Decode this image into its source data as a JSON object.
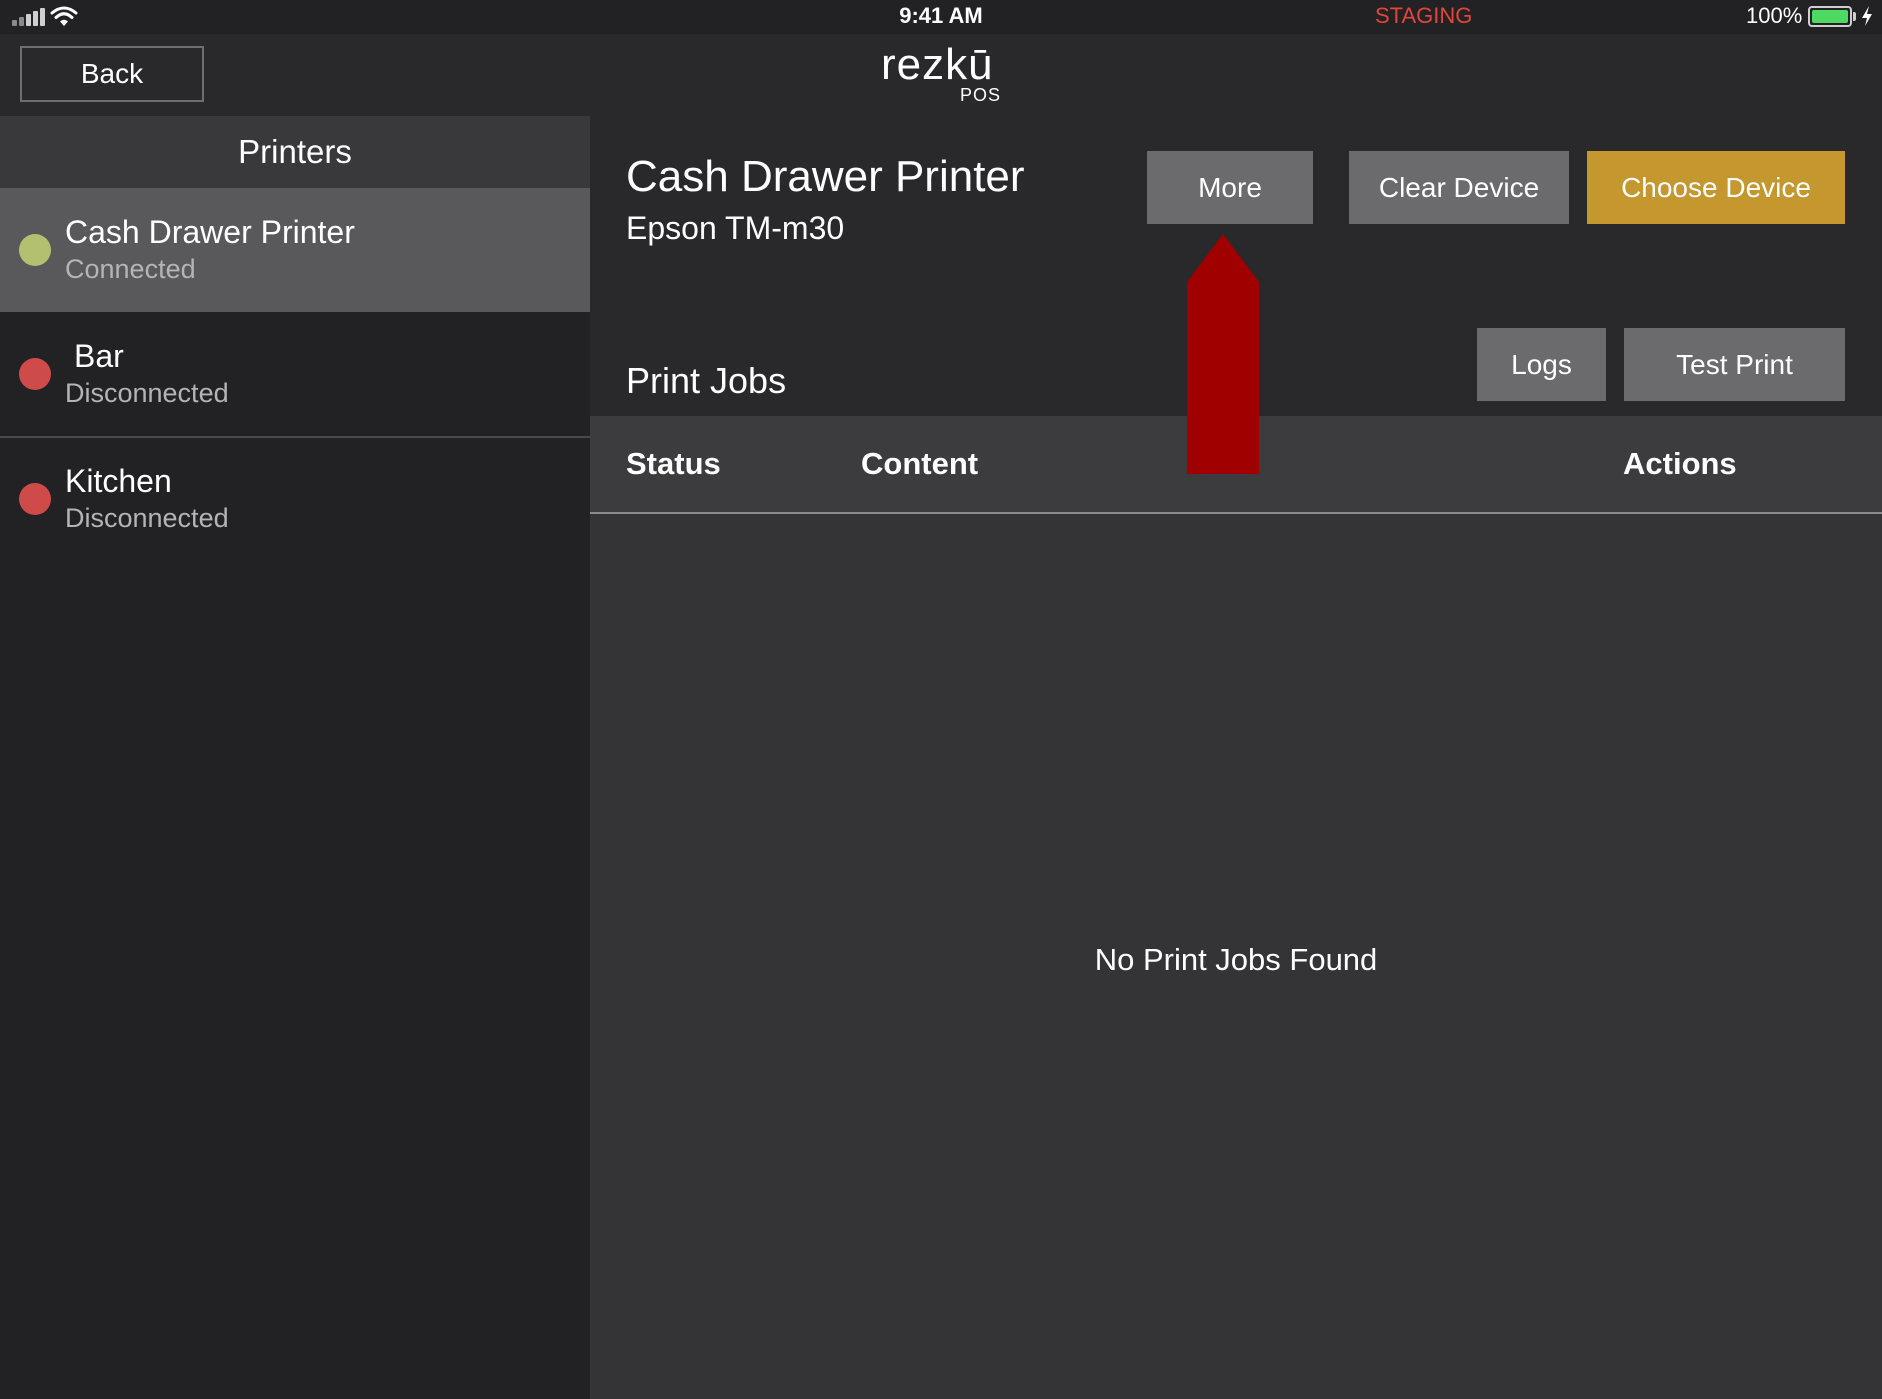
{
  "status_bar": {
    "time": "9:41 AM",
    "environment": "STAGING",
    "battery": "100%",
    "signal_icon": "cellular-signal-icon",
    "wifi_icon": "wifi-icon",
    "battery_icon": "battery-icon",
    "charging_icon": "charging-bolt-icon"
  },
  "nav": {
    "back_label": "Back",
    "logo_main": "rezkū",
    "logo_sub": "POS"
  },
  "sidebar": {
    "title": "Printers",
    "items": [
      {
        "name": "Cash Drawer Printer",
        "status": "Connected",
        "selected": true,
        "dot_color": "#b3c06f"
      },
      {
        "name": "Bar",
        "status": "Disconnected",
        "selected": false,
        "dot_color": "#cf4b4a"
      },
      {
        "name": "Kitchen",
        "status": "Disconnected",
        "selected": false,
        "dot_color": "#cf4b4a"
      }
    ]
  },
  "device": {
    "name": "Cash Drawer Printer",
    "model": "Epson TM-m30",
    "more_label": "More",
    "clear_label": "Clear Device",
    "choose_label": "Choose Device"
  },
  "jobs": {
    "title": "Print Jobs",
    "logs_label": "Logs",
    "test_print_label": "Test Print",
    "columns": [
      "Status",
      "Content",
      "Actions"
    ],
    "empty_message": "No Print Jobs Found"
  },
  "colors": {
    "accent_gold": "#c4972f",
    "annotation_arrow": "#a00000",
    "staging_red": "#e0463c"
  }
}
